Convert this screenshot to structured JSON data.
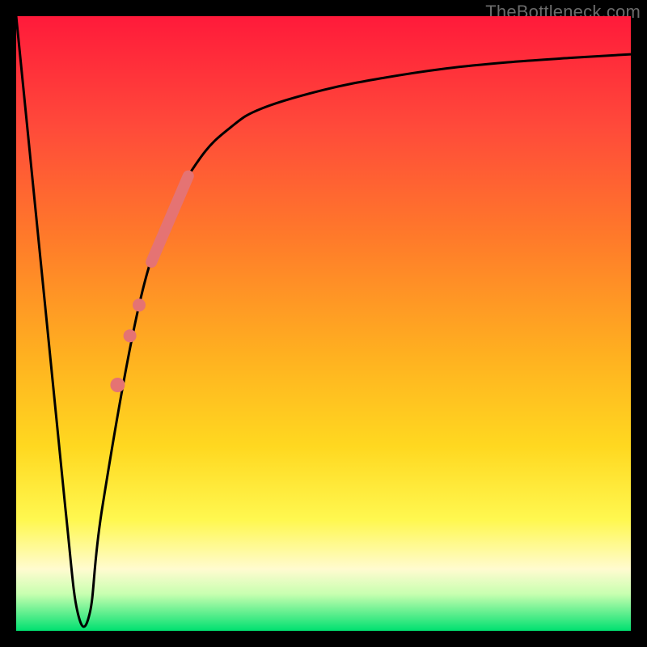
{
  "attribution": "TheBottleneck.com",
  "colors": {
    "frame": "#000000",
    "curve_stroke": "#000000",
    "marker_fill": "#e57373",
    "marker_stroke": "#e57373",
    "gradient_stops": [
      "#ff1a3a",
      "#ff4a3a",
      "#ff7a2a",
      "#ffb020",
      "#ffd820",
      "#fff850",
      "#fffbd0",
      "#c8ffb0",
      "#00e070"
    ]
  },
  "chart_data": {
    "type": "line",
    "title": "",
    "xlabel": "",
    "ylabel": "",
    "xlim": [
      0,
      100
    ],
    "ylim": [
      0,
      100
    ],
    "series": [
      {
        "name": "bottleneck-curve",
        "x": [
          0,
          4,
          8,
          10,
          12,
          14,
          20,
          25,
          30,
          35,
          40,
          50,
          60,
          70,
          80,
          90,
          100
        ],
        "y": [
          100,
          60,
          20,
          3,
          3,
          20,
          53,
          68,
          77,
          82,
          85,
          88,
          90,
          91.5,
          92.5,
          93.2,
          93.8
        ]
      }
    ],
    "markers": [
      {
        "type": "segment",
        "x1": 22,
        "y1": 60,
        "x2": 28,
        "y2": 74,
        "width": 14
      },
      {
        "type": "dot",
        "x": 20.0,
        "y": 53.0,
        "r": 8
      },
      {
        "type": "dot",
        "x": 18.5,
        "y": 48.0,
        "r": 8
      },
      {
        "type": "dot",
        "x": 16.5,
        "y": 40.0,
        "r": 9
      }
    ]
  }
}
